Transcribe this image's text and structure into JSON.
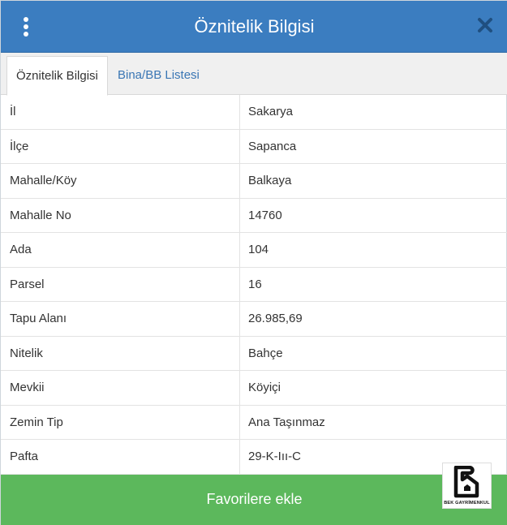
{
  "header": {
    "title": "Öznitelik Bilgisi",
    "menu_icon": "vertical-ellipsis-icon",
    "close_icon": "close-icon",
    "bg_color": "#3b7dc0"
  },
  "tabs": [
    {
      "label": "Öznitelik Bilgisi",
      "active": true
    },
    {
      "label": "Bina/BB Listesi",
      "active": false
    }
  ],
  "attributes": [
    {
      "label": "İl",
      "value": "Sakarya"
    },
    {
      "label": "İlçe",
      "value": "Sapanca"
    },
    {
      "label": "Mahalle/Köy",
      "value": "Balkaya"
    },
    {
      "label": "Mahalle No",
      "value": "14760"
    },
    {
      "label": "Ada",
      "value": "104"
    },
    {
      "label": "Parsel",
      "value": "16"
    },
    {
      "label": "Tapu Alanı",
      "value": "26.985,69"
    },
    {
      "label": "Nitelik",
      "value": "Bahçe"
    },
    {
      "label": "Mevkii",
      "value": "Köyiçi"
    },
    {
      "label": "Zemin Tip",
      "value": "Ana Taşınmaz"
    },
    {
      "label": "Pafta",
      "value": "29-K-Iıı-C"
    }
  ],
  "favorite_button": {
    "label": "Favorilere ekle",
    "color": "#5cb85c"
  },
  "logo": {
    "text": "BEK GAYRİMENKUL"
  }
}
